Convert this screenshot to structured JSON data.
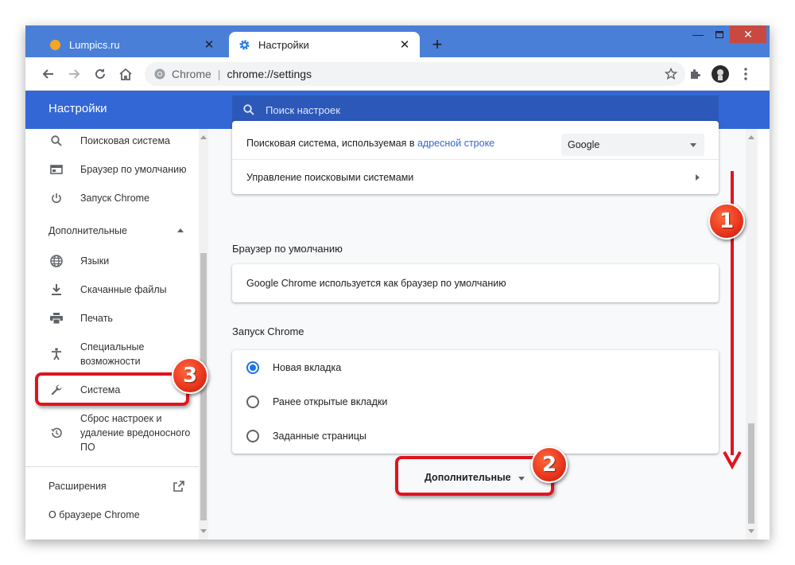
{
  "browser": {
    "tabs": [
      {
        "title": "Lumpics.ru",
        "favicon": "orange-circle-icon",
        "active": false
      },
      {
        "title": "Настройки",
        "favicon": "gear-icon",
        "active": true
      }
    ],
    "new_tab": "+",
    "address": {
      "site_label": "Chrome",
      "separator": "|",
      "url": "chrome://settings"
    }
  },
  "settings": {
    "header_title": "Настройки",
    "search_placeholder": "Поиск настроек"
  },
  "sidebar": {
    "items_top": [
      {
        "label": "Поисковая система",
        "icon": "search-icon"
      },
      {
        "label": "Браузер по умолчанию",
        "icon": "browser-window-icon"
      },
      {
        "label": "Запуск Chrome",
        "icon": "power-icon"
      }
    ],
    "advanced_group": "Дополнительные",
    "items_advanced": [
      {
        "label": "Языки",
        "icon": "globe-icon"
      },
      {
        "label": "Скачанные файлы",
        "icon": "download-icon"
      },
      {
        "label": "Печать",
        "icon": "printer-icon"
      },
      {
        "label": "Специальные возможности",
        "icon": "accessibility-icon"
      },
      {
        "label": "Система",
        "icon": "wrench-icon"
      },
      {
        "label": "Сброс настроек и удаление вредоносного ПО",
        "icon": "restore-icon"
      }
    ],
    "extensions": "Расширения",
    "about": "О браузере Chrome"
  },
  "main": {
    "search_engine": {
      "row1_text": "Поисковая система, используемая в ",
      "row1_link": "адресной строке",
      "selected": "Google",
      "row2_text": "Управление поисковыми системами"
    },
    "default_browser": {
      "title": "Браузер по умолчанию",
      "text": "Google Chrome используется как браузер по умолчанию"
    },
    "startup": {
      "title": "Запуск Chrome",
      "options": [
        "Новая вкладка",
        "Ранее открытые вкладки",
        "Заданные страницы"
      ],
      "selected_index": 0
    },
    "advanced_button": "Дополнительные"
  },
  "annotations": {
    "badges": [
      "1",
      "2",
      "3"
    ],
    "color": "#e0141e"
  }
}
